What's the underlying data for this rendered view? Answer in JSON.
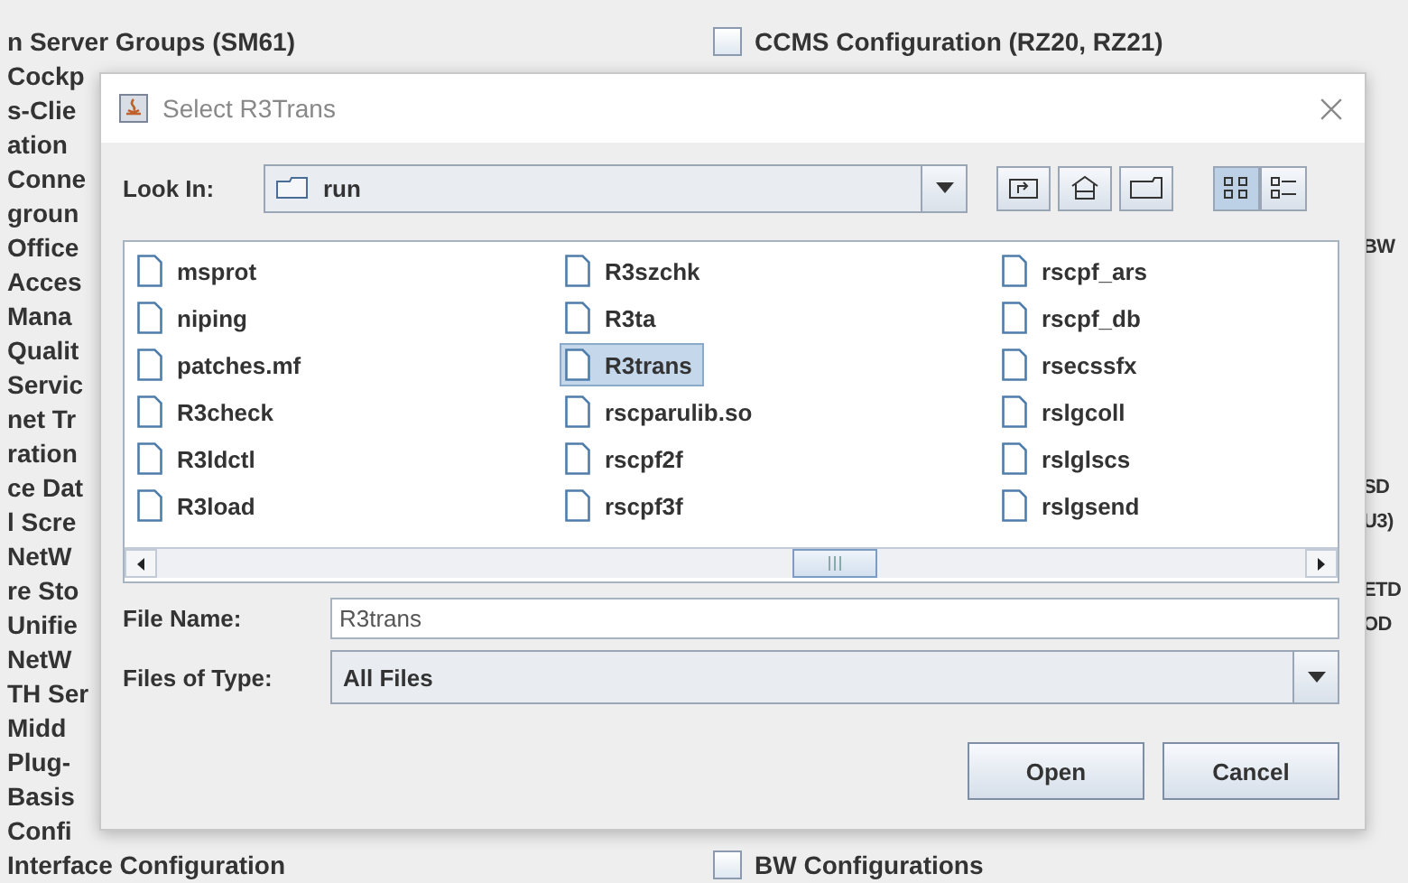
{
  "background": {
    "rows": [
      {
        "left": "n Server Groups (SM61)",
        "right": {
          "kind": "checkbox",
          "text": "CCMS Configuration (RZ20, RZ21)",
          "checked": false
        }
      },
      {
        "left": "Cockp"
      },
      {
        "left": "s-Clie"
      },
      {
        "left": "ation"
      },
      {
        "left": "Conne"
      },
      {
        "left": "groun"
      },
      {
        "left": "Office",
        "right": {
          "kind": "fragment",
          "text": "BW"
        }
      },
      {
        "left": "Acces"
      },
      {
        "left": "Mana"
      },
      {
        "left": "Qualit"
      },
      {
        "left": "Servic"
      },
      {
        "left": "net Tr"
      },
      {
        "left": "ration"
      },
      {
        "left": "ce Dat",
        "right": {
          "kind": "fragment",
          "text": "SD"
        }
      },
      {
        "left": "l Scre",
        "right": {
          "kind": "fragment",
          "text": "U3)"
        }
      },
      {
        "left": "NetW"
      },
      {
        "left": "re Sto",
        "right": {
          "kind": "fragment",
          "text": "ETD"
        }
      },
      {
        "left": "Unifie",
        "right": {
          "kind": "fragment",
          "text": "OD"
        }
      },
      {
        "left": "NetW"
      },
      {
        "left": "TH Ser"
      },
      {
        "left": "Midd"
      },
      {
        "left": "Plug-"
      },
      {
        "left": "Basis"
      },
      {
        "left": "Confi"
      },
      {
        "left": "Interface Configuration",
        "right": {
          "kind": "checkbox",
          "text": "BW Configurations",
          "checked": false
        }
      }
    ]
  },
  "dialog": {
    "title": "Select R3Trans",
    "look_in": {
      "label": "Look In:",
      "value": "run"
    },
    "view_modes": [
      {
        "selected": true
      },
      {
        "selected": false
      }
    ],
    "files": [
      {
        "name": "msprot",
        "selected": false
      },
      {
        "name": "niping",
        "selected": false
      },
      {
        "name": "patches.mf",
        "selected": false
      },
      {
        "name": "R3check",
        "selected": false
      },
      {
        "name": "R3ldctl",
        "selected": false
      },
      {
        "name": "R3load",
        "selected": false
      },
      {
        "name": "R3szchk",
        "selected": false
      },
      {
        "name": "R3ta",
        "selected": false
      },
      {
        "name": "R3trans",
        "selected": true
      },
      {
        "name": "rscparulib.so",
        "selected": false
      },
      {
        "name": "rscpf2f",
        "selected": false
      },
      {
        "name": "rscpf3f",
        "selected": false
      },
      {
        "name": "rscpf_ars",
        "selected": false
      },
      {
        "name": "rscpf_db",
        "selected": false
      },
      {
        "name": "rsecssfx",
        "selected": false
      },
      {
        "name": "rslgcoll",
        "selected": false
      },
      {
        "name": "rslglscs",
        "selected": false
      },
      {
        "name": "rslgsend",
        "selected": false
      }
    ],
    "file_name": {
      "label": "File Name:",
      "value": "R3trans"
    },
    "file_type": {
      "label": "Files of Type:",
      "value": "All Files"
    },
    "buttons": [
      "Open",
      "Cancel"
    ]
  }
}
